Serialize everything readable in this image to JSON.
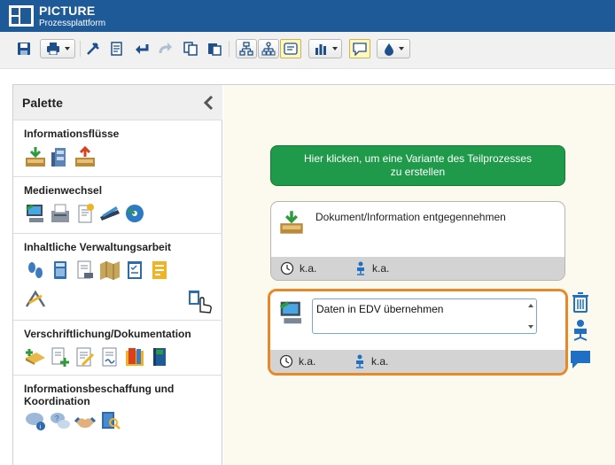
{
  "app": {
    "title": "PICTURE",
    "subtitle": "Prozessplattform"
  },
  "colors": {
    "title_bar": "#1f5a98",
    "variant_button": "#1f9a4a",
    "selected_border": "#e7892a",
    "canvas_bg": "#fcf9ee",
    "action_icon": "#1f6fc5"
  },
  "toolbar": {
    "buttons": [
      {
        "icon": "save-icon"
      },
      {
        "icon": "print-icon",
        "dropdown": true
      },
      {
        "icon": "tools-icon"
      },
      {
        "icon": "checklist-icon"
      },
      {
        "icon": "undo-icon"
      },
      {
        "icon": "redo-icon"
      },
      {
        "icon": "copy-icon"
      },
      {
        "icon": "paste-icon"
      },
      {
        "icon": "hierarchy-icon"
      },
      {
        "icon": "tree-icon"
      },
      {
        "icon": "card-view-icon"
      },
      {
        "icon": "chart-icon",
        "dropdown": true
      },
      {
        "icon": "comment-icon"
      },
      {
        "icon": "color-drop-icon",
        "dropdown": true
      }
    ]
  },
  "palette": {
    "title": "Palette",
    "sections": [
      {
        "title": "Informationsflüsse",
        "icons": [
          "inbox-icon",
          "archive-icon",
          "outbox-icon"
        ]
      },
      {
        "title": "Medienwechsel",
        "icons": [
          "computer-icon",
          "fax-icon",
          "document-star-icon",
          "scanner-icon",
          "cd-icon"
        ]
      },
      {
        "title": "Inhaltliche Verwaltungsarbeit",
        "icons": [
          "footprints-icon",
          "calculator-icon",
          "document-stamp-icon",
          "map-icon",
          "checklist-icon",
          "form-icon",
          "compass-icon",
          "hand-pointer-icon"
        ]
      },
      {
        "title": "Verschriftlichung/Dokumentation",
        "icons": [
          "new-file-icon",
          "add-document-icon",
          "edit-document-icon",
          "sign-document-icon",
          "folder-icon",
          "binder-icon"
        ]
      },
      {
        "title": "Informationsbeschaffung und Koordination",
        "icons": [
          "info-speech-icon",
          "question-speech-icon",
          "handshake-icon",
          "search-book-icon"
        ]
      }
    ]
  },
  "canvas": {
    "variant_button": {
      "line1": "Hier klicken, um eine Variante des Teilprozesses",
      "line2": "zu erstellen"
    },
    "cards": [
      {
        "label": "Dokument/Information entgegennehmen",
        "time": "k.a.",
        "person": "k.a.",
        "icon": "inbox-icon"
      },
      {
        "label": "Daten in EDV übernehmen",
        "time": "k.a.",
        "person": "k.a.",
        "icon": "computer-icon",
        "selected": true
      }
    ],
    "side_actions": [
      "trash-icon",
      "person-chair-icon",
      "comment-icon"
    ]
  }
}
